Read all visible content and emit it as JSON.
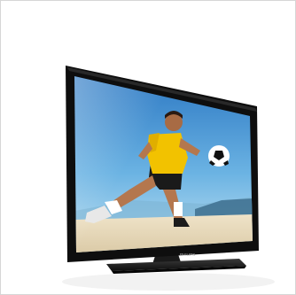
{
  "product": {
    "type": "television",
    "brand_label": "PHILIPS",
    "screen_scene": "footballer-kicking-ball-on-beach"
  },
  "colors": {
    "bezel": "#111111",
    "sky_top": "#2f7fc9",
    "sky_bottom": "#a9d6ee",
    "sand": "#e9dcc0",
    "jersey": "#f2c200",
    "frame_border": "#d6d6d6"
  }
}
